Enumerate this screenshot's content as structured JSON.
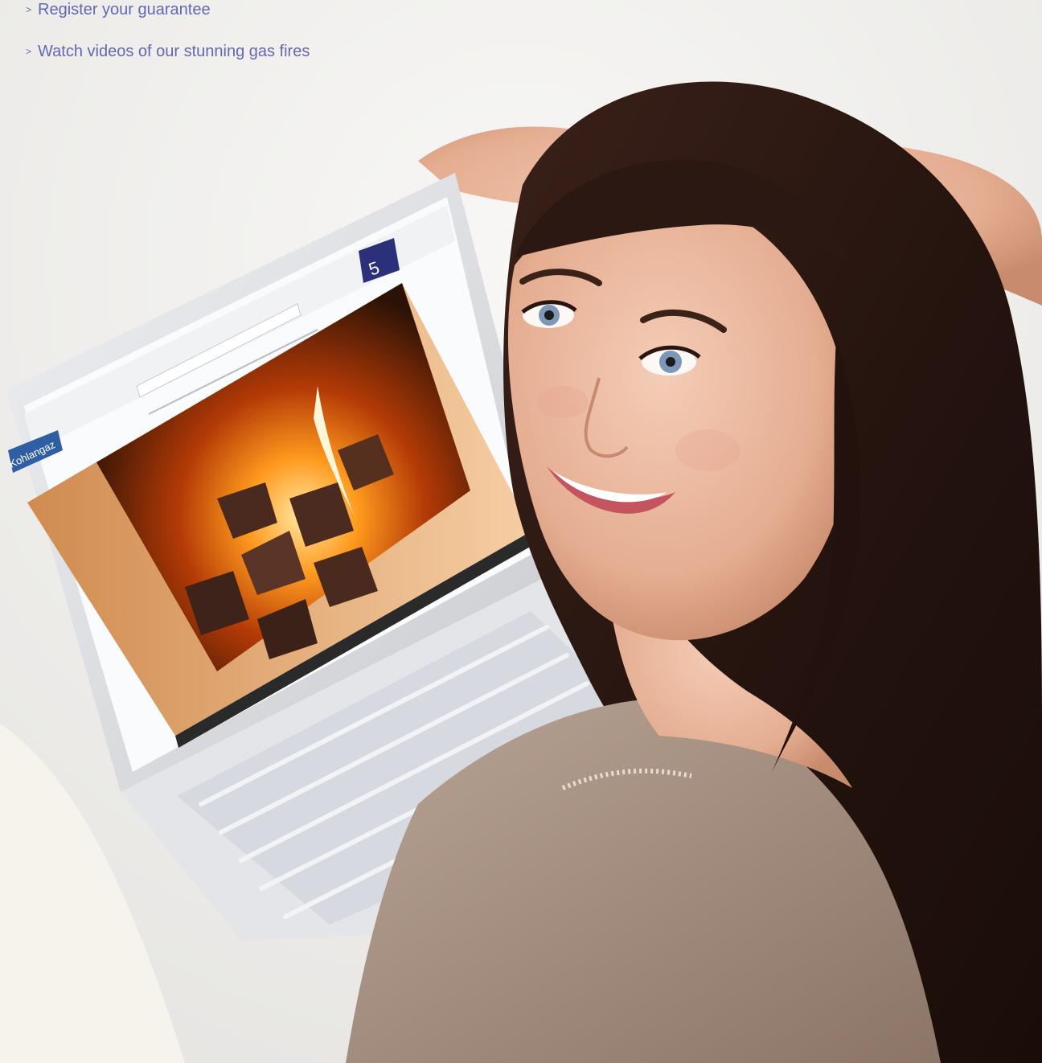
{
  "links": [
    {
      "chevron": ">",
      "label": "Register your guarantee"
    },
    {
      "chevron": ">",
      "label": "Watch videos of our stunning gas fires"
    }
  ],
  "photo": {
    "screen_logo": "Kohlangaz",
    "badge_number": "5"
  },
  "colors": {
    "link": "#6367b4",
    "background": "#f1f0ee",
    "hair": "#2a1712",
    "skin": "#e7b49a",
    "top": "#a48e7e",
    "laptop": "#dcdde1"
  }
}
